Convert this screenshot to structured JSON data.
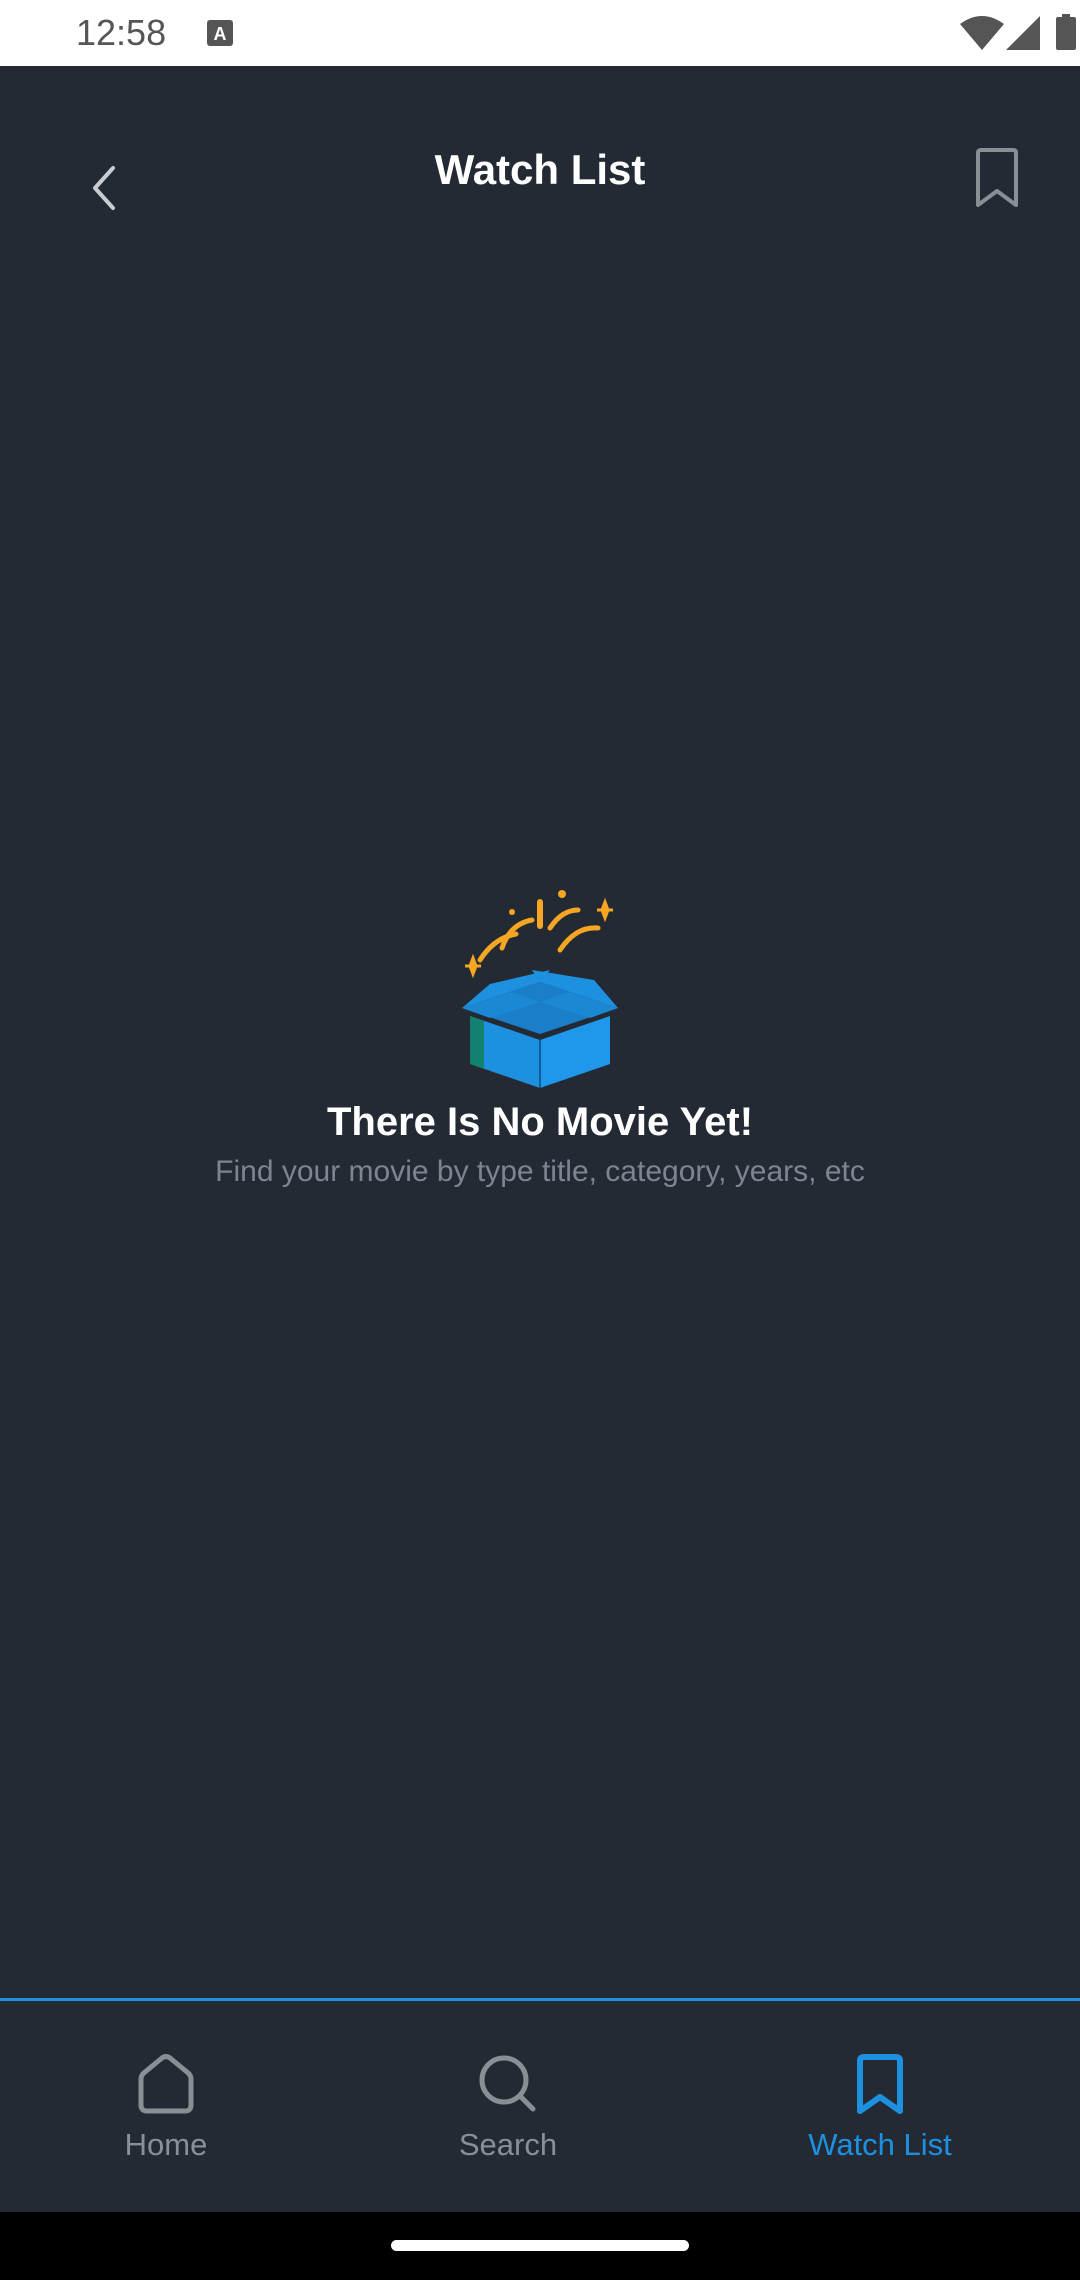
{
  "status_bar": {
    "time": "12:58",
    "icons": [
      "a-notification-icon",
      "wifi-icon",
      "signal-icon",
      "battery-icon"
    ]
  },
  "header": {
    "title": "Watch List",
    "back_icon": "chevron-left-icon",
    "action_icon": "bookmark-icon"
  },
  "empty_state": {
    "illustration": "open-gift-box-icon",
    "title": "There Is No Movie Yet!",
    "subtitle": "Find your movie by type title, category, years, etc"
  },
  "bottom_nav": {
    "items": [
      {
        "label": "Home",
        "icon": "home-icon",
        "active": false
      },
      {
        "label": "Search",
        "icon": "search-icon",
        "active": false
      },
      {
        "label": "Watch List",
        "icon": "bookmark-icon",
        "active": true
      }
    ]
  },
  "colors": {
    "background": "#242a33",
    "accent": "#1e90e0",
    "inactive": "#8a8f96",
    "subtitle": "#7d8590",
    "sparkle": "#f5a623",
    "box": "#1e90e0"
  }
}
